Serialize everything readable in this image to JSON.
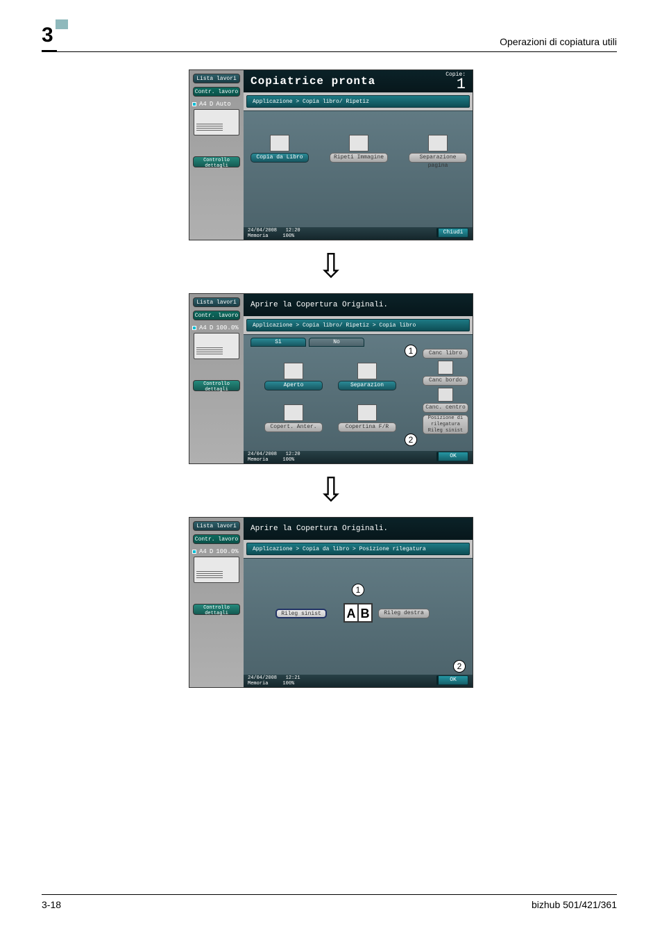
{
  "page": {
    "chapter_number": "3",
    "header_title": "Operazioni di copiatura utili",
    "footer_left": "3-18",
    "footer_right": "bizhub 501/421/361"
  },
  "common": {
    "lista_lavori": "Lista lavori",
    "contr_lavoro": "Contr. lavoro",
    "controllo_dettagli": "Controllo dettagli",
    "a4": "A4",
    "d": "D",
    "auto": "Auto",
    "zoom": "100.0%",
    "date": "24/04/2008",
    "memoria": "Memoria",
    "mem_pct": "100%"
  },
  "panel1": {
    "title": "Copiatrice pronta",
    "copies_label": "Copie:",
    "copies_value": "1",
    "breadcrumb": "Applicazione > Copia libro/ Ripetiz",
    "btn_copia_libro": "Copia da Libro",
    "btn_ripeti": "Ripeti Immagine",
    "btn_separazione": "Separazione pagina",
    "time": "12:20",
    "close": "Chiudi"
  },
  "panel2": {
    "title": "Aprire la Copertura Originali.",
    "breadcrumb": "Applicazione > Copia libro/ Ripetiz > Copia libro",
    "tab_si": "Sì",
    "tab_no": "No",
    "btn_aperto": "Aperto",
    "btn_separazion": "Separazion",
    "btn_copert_anter": "Copert. Anter.",
    "btn_copertina_fr": "Copertina F/R",
    "side_canc_libro": "Canc libro",
    "side_canc_bordo": "Canc bordo",
    "side_canc_centro": "Canc. centro",
    "side_posizione": "Posizione di rilegatura Rileg sinist",
    "time": "12:20",
    "ok": "OK",
    "callout1": "1",
    "callout2": "2"
  },
  "panel3": {
    "title": "Aprire la Copertura Originali.",
    "breadcrumb": "Applicazione > Copia da libro > Posizione rilegatura",
    "btn_rileg_sinist": "Rileg sinist",
    "btn_rileg_destra": "Rileg destra",
    "ab_a": "A",
    "ab_b": "B",
    "time": "12:21",
    "ok": "OK",
    "callout1": "1",
    "callout2": "2"
  }
}
